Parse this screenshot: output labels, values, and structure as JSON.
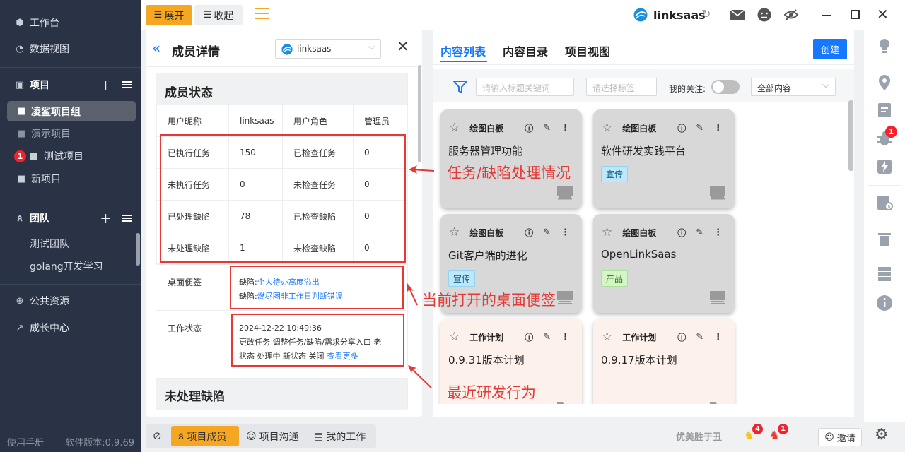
{
  "sidebar": {
    "workbench": "工作台",
    "data_view": "数据视图",
    "projects_header": "项目",
    "projects": [
      {
        "label": "凌鲨项目组",
        "active": true
      },
      {
        "label": "演示项目",
        "dim": true
      },
      {
        "label": "测试项目",
        "badge": "1"
      },
      {
        "label": "新项目"
      }
    ],
    "team_header": "团队",
    "teams": [
      "测试团队",
      "golang开发学习"
    ],
    "public_resources": "公共资源",
    "growth_center": "成长中心",
    "manual": "使用手册",
    "version": "软件版本:0.9.69"
  },
  "topbar": {
    "expand": "展开",
    "collapse": "收起",
    "app_name": "linksaas"
  },
  "member_panel": {
    "title": "成员详情",
    "project_select": "linksaas",
    "status_title": "成员状态",
    "rows": [
      [
        "用户昵称",
        "linksaas",
        "用户角色",
        "管理员"
      ],
      [
        "已执行任务",
        "150",
        "已检查任务",
        "0"
      ],
      [
        "未执行任务",
        "0",
        "未检查任务",
        "0"
      ],
      [
        "已处理缺陷",
        "78",
        "已检查缺陷",
        "0"
      ],
      [
        "未处理缺陷",
        "1",
        "未检查缺陷",
        "0"
      ]
    ],
    "desk_note_label": "桌面便签",
    "desk_notes": [
      {
        "prefix": "缺陷:",
        "text": "个人待办高度溢出"
      },
      {
        "prefix": "缺陷:",
        "text": "燃尽图非工作日判断错误"
      }
    ],
    "work_status_label": "工作状态",
    "work_status_time": "2024-12-22 10:49:36",
    "work_status_line1": "更改任务 调整任务/缺陷/需求分享入口 老",
    "work_status_line2": "状态 处理中 新状态 关闭",
    "see_more": "查看更多",
    "unhandled_title": "未处理缺陷"
  },
  "annotations": {
    "task_bug": "任务/缺陷处理情况",
    "desk_note": "当前打开的桌面便签",
    "recent": "最近研发行为"
  },
  "content_panel": {
    "tabs": [
      "内容列表",
      "内容目录",
      "项目视图"
    ],
    "create": "创建",
    "search_placeholder": "请输入标题关键词",
    "tag_placeholder": "请选择标签",
    "my_follow": "我的关注:",
    "filter_select": "全部内容",
    "cards": [
      {
        "type": "绘图白板",
        "title": "服务器管理功能",
        "tag": "",
        "style": "gray"
      },
      {
        "type": "绘图白板",
        "title": "软件研发实践平台",
        "tag": "宣传",
        "tag_style": "blue",
        "style": "gray"
      },
      {
        "type": "绘图白板",
        "title": "Git客户端的进化",
        "tag": "宣传",
        "tag_style": "blue",
        "style": "gray"
      },
      {
        "type": "绘图白板",
        "title": "OpenLinkSaas",
        "tag": "产品",
        "tag_style": "green",
        "style": "gray"
      },
      {
        "type": "工作计划",
        "title": "0.9.31版本计划",
        "tag": "",
        "style": "pink"
      },
      {
        "type": "工作计划",
        "title": "0.9.17版本计划",
        "tag": "",
        "style": "pink"
      }
    ]
  },
  "right_rail": {
    "bug_badge": "1"
  },
  "bottom": {
    "tabs": [
      "项目成员",
      "项目沟通",
      "我的工作"
    ],
    "motto": "优美胜于丑",
    "badge_a": "4",
    "badge_b": "1",
    "invite": "邀请"
  },
  "colors": {
    "sidebar_bg": "#2a3346",
    "accent_orange": "#f5a623",
    "primary_blue": "#1677ff",
    "annotation_red": "#e53935"
  }
}
